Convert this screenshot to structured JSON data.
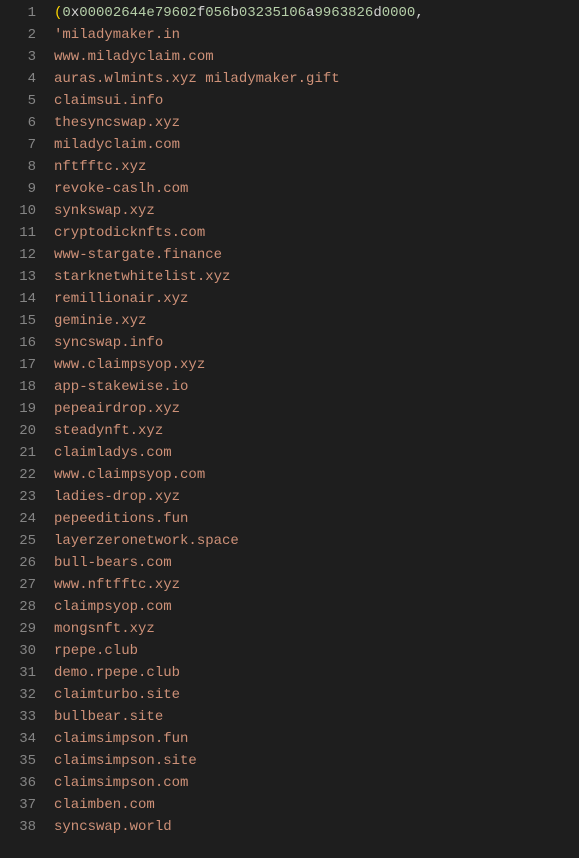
{
  "code": {
    "line1": {
      "paren": "(",
      "p1": "0",
      "x": "x",
      "p2": "00002644e79602",
      "f": "f",
      "p3": "056",
      "b": "b",
      "p4": "03235106",
      "a": "a",
      "p5": "9963826",
      "d": "d",
      "p6": "0000",
      "comma": ","
    },
    "lines": [
      "'miladymaker.in",
      "www.miladyclaim.com",
      "auras.wlmints.xyz miladymaker.gift",
      "claimsui.info",
      "thesyncswap.xyz",
      "miladyclaim.com",
      "nftfftc.xyz",
      "revoke-caslh.com",
      "synkswap.xyz",
      "cryptodicknfts.com",
      "www-stargate.finance",
      "starknetwhitelist.xyz",
      "remillionair.xyz",
      "geminie.xyz",
      "syncswap.info",
      "www.claimpsyop.xyz",
      "app-stakewise.io",
      "pepeairdrop.xyz",
      "steadynft.xyz",
      "claimladys.com",
      "www.claimpsyop.com",
      "ladies-drop.xyz",
      "pepeeditions.fun",
      "layerzeronetwork.space",
      "bull-bears.com",
      "www.nftfftc.xyz",
      "claimpsyop.com",
      "mongsnft.xyz",
      "rpepe.club",
      "demo.rpepe.club",
      "claimturbo.site",
      "bullbear.site",
      "claimsimpson.fun",
      "claimsimpson.site",
      "claimsimpson.com",
      "claimben.com",
      "syncswap.world"
    ]
  },
  "gutter": {
    "start": 1,
    "end": 38
  }
}
